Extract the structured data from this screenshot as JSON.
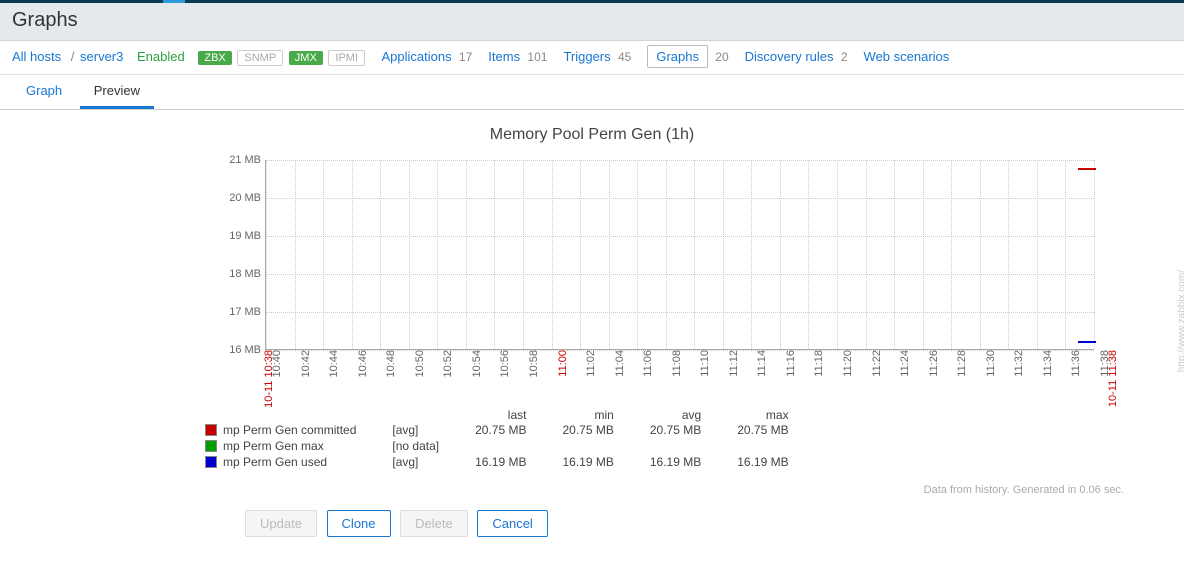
{
  "page": {
    "title": "Graphs"
  },
  "breadcrumb": {
    "all_hosts": "All hosts",
    "host": "server3",
    "enabled": "Enabled"
  },
  "agent_badges": {
    "zbx": "ZBX",
    "snmp": "SNMP",
    "jmx": "JMX",
    "ipmi": "IPMI"
  },
  "hostnav_items": [
    {
      "label": "Applications",
      "count": "17"
    },
    {
      "label": "Items",
      "count": "101"
    },
    {
      "label": "Triggers",
      "count": "45"
    },
    {
      "label": "Graphs",
      "count": "20",
      "selected": true
    },
    {
      "label": "Discovery rules",
      "count": "2"
    },
    {
      "label": "Web scenarios",
      "count": ""
    }
  ],
  "tabs": {
    "graph": "Graph",
    "preview": "Preview"
  },
  "chart_data": {
    "type": "line",
    "title": "Memory Pool Perm Gen (1h)",
    "ylabel": "",
    "ylim": [
      16,
      21
    ],
    "y_ticks": [
      "16 MB",
      "17 MB",
      "18 MB",
      "19 MB",
      "20 MB",
      "21 MB"
    ],
    "x_ticks": [
      "10:40",
      "10:42",
      "10:44",
      "10:46",
      "10:48",
      "10:50",
      "10:52",
      "10:54",
      "10:56",
      "10:58",
      "11:00",
      "11:02",
      "11:04",
      "11:06",
      "11:08",
      "11:10",
      "11:12",
      "11:14",
      "11:16",
      "11:18",
      "11:20",
      "11:22",
      "11:24",
      "11:26",
      "11:28",
      "11:30",
      "11:32",
      "11:34",
      "11:36",
      "11:38"
    ],
    "x_start_label": "10-11 10:38",
    "x_end_label": "10-11 11:38",
    "legend_headers": [
      "last",
      "min",
      "avg",
      "max"
    ],
    "series": [
      {
        "name": "mp Perm Gen committed",
        "color": "#c40000",
        "agg": "[avg]",
        "last": "20.75 MB",
        "min": "20.75 MB",
        "avg": "20.75 MB",
        "max": "20.75 MB"
      },
      {
        "name": "mp Perm Gen max",
        "color": "#00a000",
        "agg": "[no data]",
        "last": "",
        "min": "",
        "avg": "",
        "max": ""
      },
      {
        "name": "mp Perm Gen used",
        "color": "#0000cc",
        "agg": "[avg]",
        "last": "16.19 MB",
        "min": "16.19 MB",
        "avg": "16.19 MB",
        "max": "16.19 MB"
      }
    ]
  },
  "footer": "Data from history. Generated in 0.06 sec.",
  "watermark": "http://www.zabbix.com/",
  "buttons": {
    "update": "Update",
    "clone": "Clone",
    "delete": "Delete",
    "cancel": "Cancel"
  }
}
